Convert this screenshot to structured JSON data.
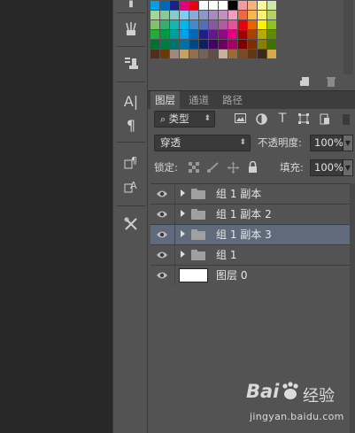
{
  "colors": {
    "tool_bg": "#535353",
    "canvas_bg": "#282828",
    "selected_layer": "#5f6a7a"
  },
  "swatch_rows": [
    [
      "#00a0e9",
      "#0068b7",
      "#1d2088",
      "#e4007f",
      "#e60012",
      "#ffffff",
      "#ffffff",
      "#ffffff",
      "#000000",
      "#f29c9f",
      "#f6b37f",
      "#fff799",
      "#c9e8a9"
    ],
    [
      "#a4d597",
      "#89c997",
      "#84ccc9",
      "#7ecef4",
      "#88abda",
      "#8c97cb",
      "#aa89bd",
      "#c490bf",
      "#f19ec2",
      "#ec6941",
      "#f8b551",
      "#fcf16e",
      "#b3d465"
    ],
    [
      "#80c269",
      "#32b16c",
      "#13b5b1",
      "#00b7ee",
      "#448aca",
      "#556fb5",
      "#8957a1",
      "#ae5da1",
      "#e85298",
      "#e60012",
      "#eb6100",
      "#fff100",
      "#8fc31f"
    ],
    [
      "#22ac38",
      "#009944",
      "#009e96",
      "#00a0e9",
      "#0068b7",
      "#1d2088",
      "#601986",
      "#920783",
      "#e4007f",
      "#a40000",
      "#a84200",
      "#b7aa00",
      "#5f8c00"
    ],
    [
      "#007130",
      "#007b43",
      "#00736d",
      "#0071a9",
      "#004986",
      "#0f1f5f",
      "#440062",
      "#6a005f",
      "#a40060",
      "#7d0000",
      "#7f2d00",
      "#8a8000",
      "#417100"
    ],
    [
      "#4f2f1b",
      "#6a3906",
      "#a1887f",
      "#c9a063",
      "#8f6f4f",
      "#736357",
      "#5e5048",
      "#c7b299",
      "#996c33",
      "#754c24",
      "#603913",
      "#3b2a1a",
      "#d5a94a"
    ]
  ],
  "tabs": [
    "图层",
    "通道",
    "路径"
  ],
  "filter": {
    "kind_label": "类型"
  },
  "blend": {
    "mode": "穿透",
    "opacity_label": "不透明度:",
    "opacity_value": "100%"
  },
  "lock": {
    "label": "锁定:",
    "fill_label": "填充:",
    "fill_value": "100%"
  },
  "layers": [
    {
      "name": "组 1 副本",
      "type": "group",
      "selected": false
    },
    {
      "name": "组 1 副本 2",
      "type": "group",
      "selected": false
    },
    {
      "name": "组 1 副本 3",
      "type": "group",
      "selected": true
    },
    {
      "name": "组 1",
      "type": "group",
      "selected": false
    },
    {
      "name": "图层 0",
      "type": "layer",
      "selected": false
    }
  ],
  "watermark": {
    "brand": "Bai",
    "brand2": "经验",
    "url": "jingyan.baidu.com"
  }
}
